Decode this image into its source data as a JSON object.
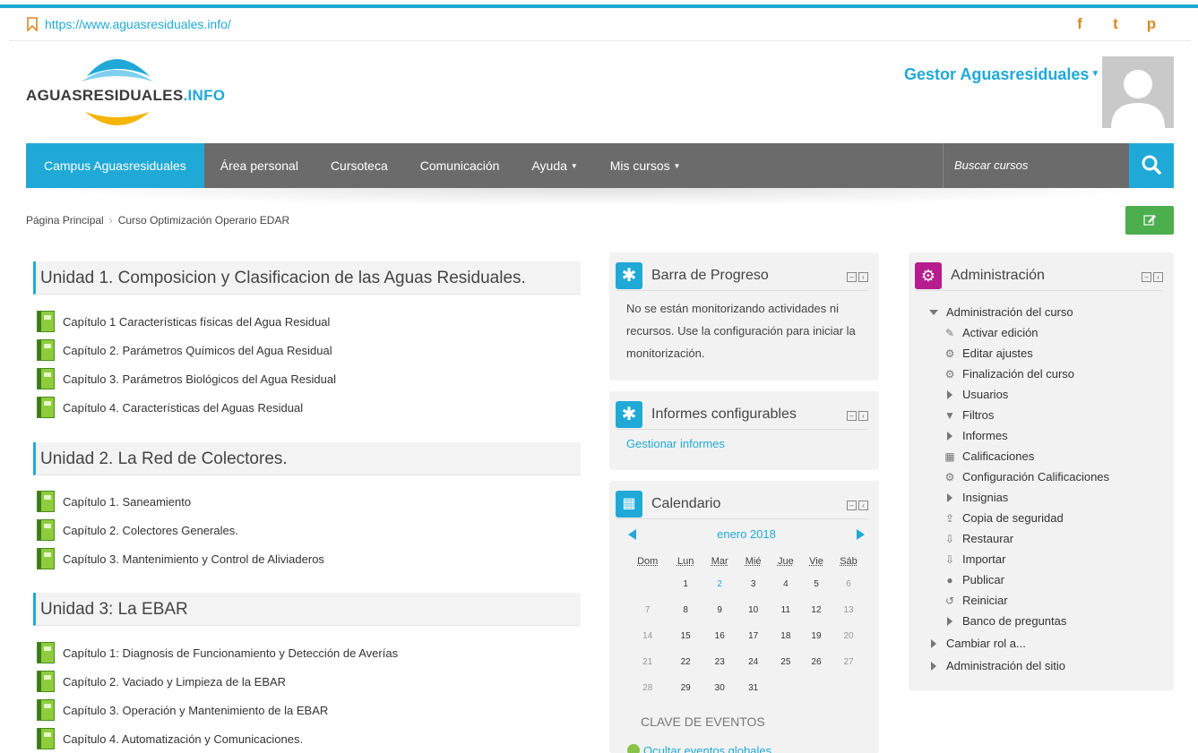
{
  "topbar": {
    "url": "https://www.aguasresiduales.info/",
    "social": [
      "f",
      "t",
      "p"
    ]
  },
  "logo": {
    "text_main": "AGUASRESIDUALES",
    "text_ext": ".INFO"
  },
  "user": {
    "name": "Gestor Aguasresiduales"
  },
  "nav": {
    "items": [
      "Campus Aguasresiduales",
      "Área personal",
      "Cursoteca",
      "Comunicación",
      "Ayuda",
      "Mis cursos"
    ],
    "search_placeholder": "Buscar cursos"
  },
  "breadcrumb": [
    "Página Principal",
    "Curso Optimización Operario EDAR"
  ],
  "units": [
    {
      "title": "Unidad 1. Composicion y Clasificacion de las Aguas Residuales.",
      "chapters": [
        "Capítulo 1 Características físicas del Agua Residual",
        "Capítulo 2. Parámetros Químicos del Agua Residual",
        "Capítulo 3. Parámetros Biológicos del Agua Residual",
        "Capítulo 4. Características del Aguas Residual"
      ]
    },
    {
      "title": "Unidad 2. La Red de Colectores.",
      "chapters": [
        "Capítulo 1. Saneamiento",
        "Capítulo 2. Colectores Generales.",
        "Capítulo 3. Mantenimiento y Control de Aliviaderos"
      ]
    },
    {
      "title": "Unidad 3: La EBAR",
      "chapters": [
        "Capítulo 1: Diagnosis de Funcionamiento y Detección de Averías",
        "Capítulo 2. Vaciado y Limpieza de la EBAR",
        "Capítulo 3. Operación y Mantenimiento de la EBAR",
        "Capítulo 4. Automatización y Comunicaciones."
      ]
    }
  ],
  "progress_block": {
    "title": "Barra de Progreso",
    "text": "No se están monitorizando actividades ni recursos. Use la configuración para iniciar la monitorización."
  },
  "reports_block": {
    "title": "Informes configurables",
    "link": "Gestionar informes"
  },
  "calendar": {
    "title": "Calendario",
    "month": "enero 2018",
    "days": [
      "Dom",
      "Lun",
      "Mar",
      "Mié",
      "Jue",
      "Vie",
      "Sáb"
    ],
    "weeks": [
      [
        "",
        "1",
        "2",
        "3",
        "4",
        "5",
        "6"
      ],
      [
        "7",
        "8",
        "9",
        "10",
        "11",
        "12",
        "13"
      ],
      [
        "14",
        "15",
        "16",
        "17",
        "18",
        "19",
        "20"
      ],
      [
        "21",
        "22",
        "23",
        "24",
        "25",
        "26",
        "27"
      ],
      [
        "28",
        "29",
        "30",
        "31",
        "",
        "",
        ""
      ]
    ],
    "today": "2",
    "events_key": "CLAVE DE EVENTOS",
    "hide_global": "Ocultar eventos globales"
  },
  "admin": {
    "title": "Administración",
    "course_admin": "Administración del curso",
    "items": [
      {
        "label": "Activar edición",
        "icon": "pencil-icon"
      },
      {
        "label": "Editar ajustes",
        "icon": "gear-icon"
      },
      {
        "label": "Finalización del curso",
        "icon": "gear-icon"
      },
      {
        "label": "Usuarios",
        "icon": "expand-icon"
      },
      {
        "label": "Filtros",
        "icon": "filter-icon"
      },
      {
        "label": "Informes",
        "icon": "expand-icon"
      },
      {
        "label": "Calificaciones",
        "icon": "grid-icon"
      },
      {
        "label": "Configuración Calificaciones",
        "icon": "gear-icon"
      },
      {
        "label": "Insignias",
        "icon": "expand-icon"
      },
      {
        "label": "Copia de seguridad",
        "icon": "upload-icon"
      },
      {
        "label": "Restaurar",
        "icon": "download-icon"
      },
      {
        "label": "Importar",
        "icon": "download-icon"
      },
      {
        "label": "Publicar",
        "icon": "globe-icon"
      },
      {
        "label": "Reiniciar",
        "icon": "reset-icon"
      },
      {
        "label": "Banco de preguntas",
        "icon": "expand-icon"
      }
    ],
    "switch_role": "Cambiar rol a...",
    "site_admin": "Administración del sitio"
  }
}
